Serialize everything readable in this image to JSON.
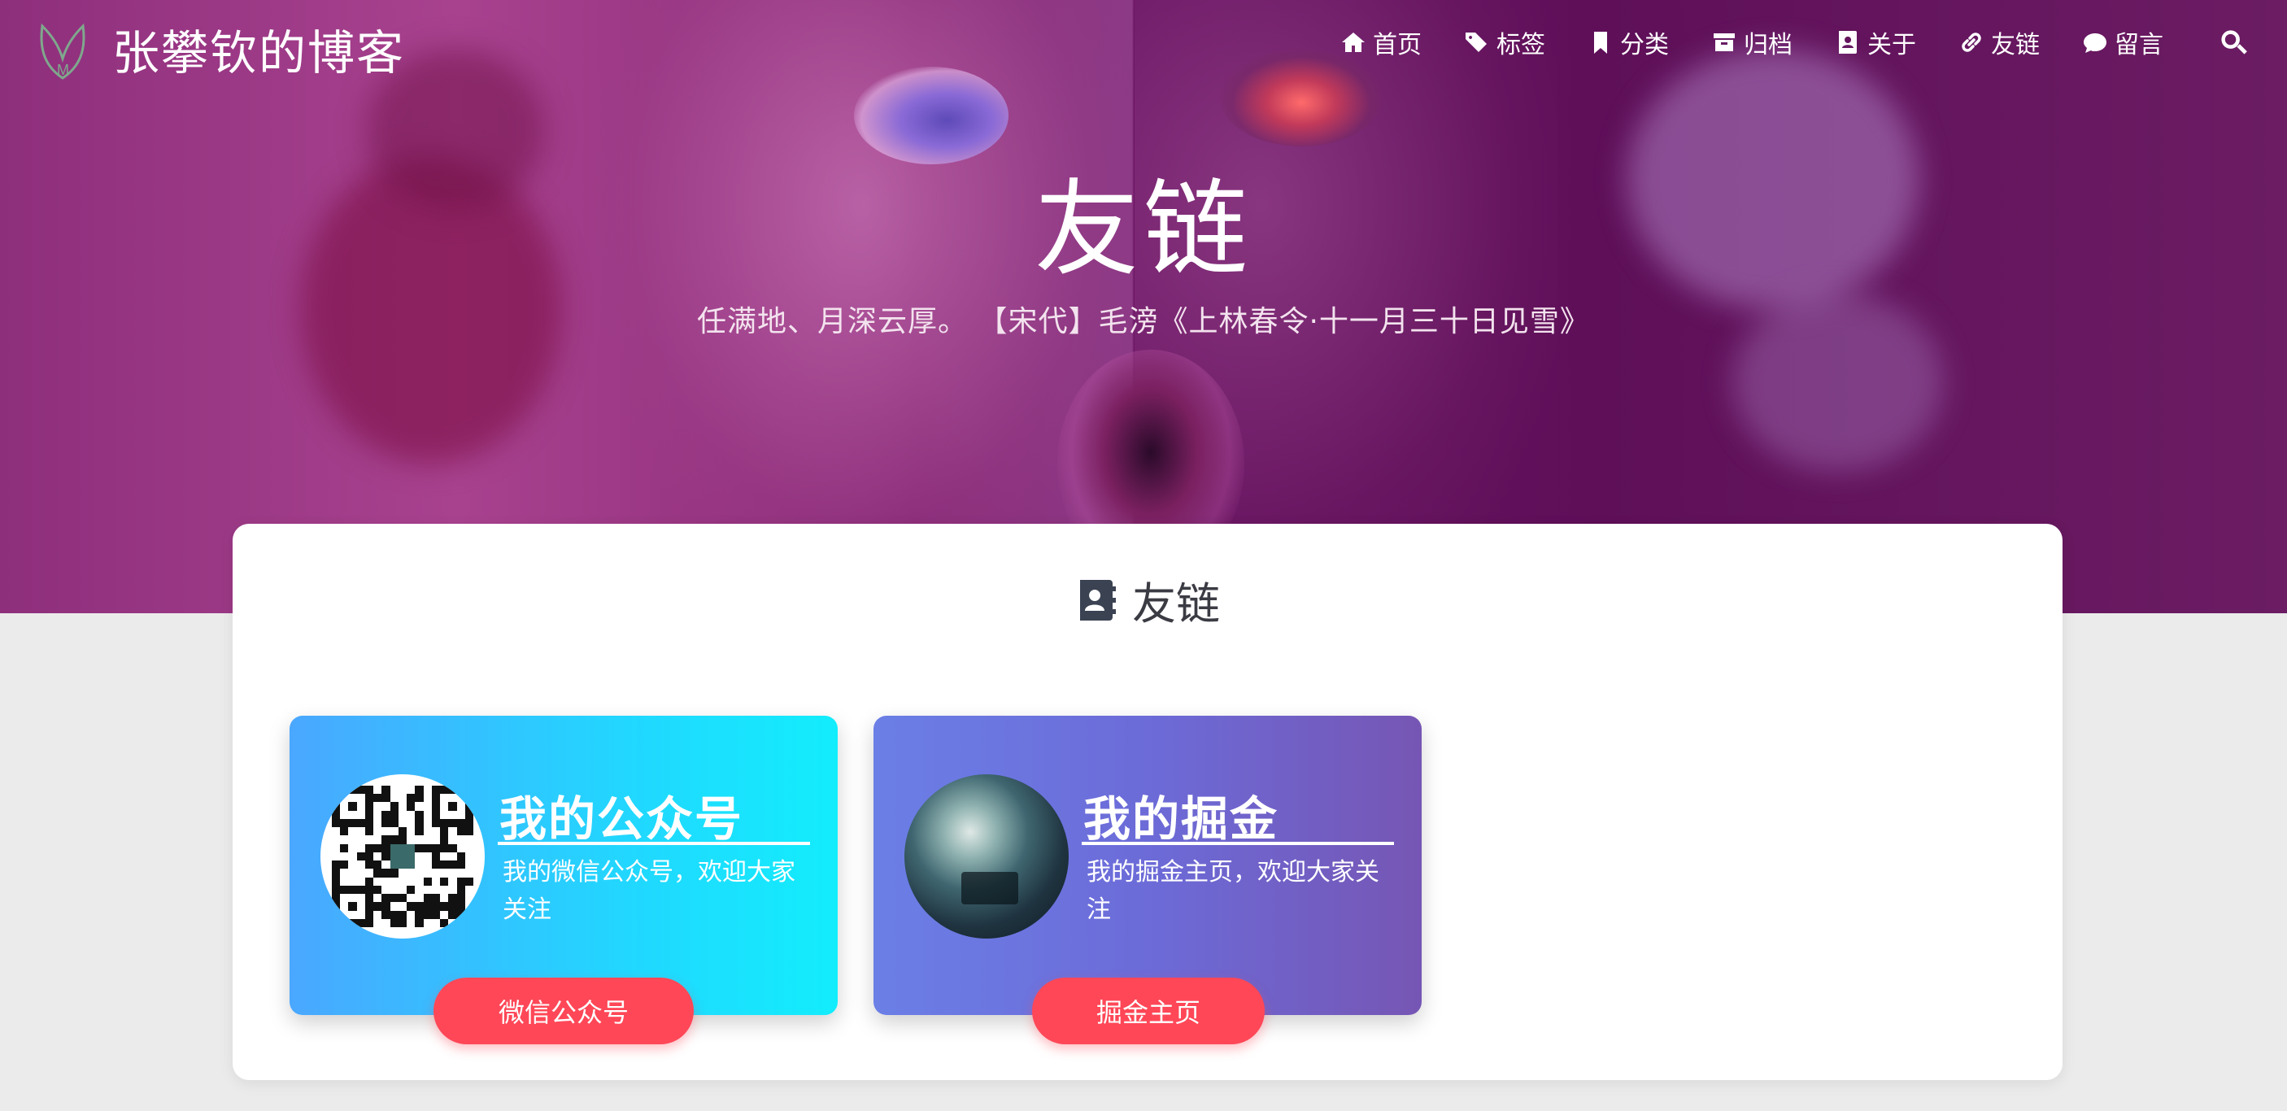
{
  "site": {
    "title": "张攀钦的博客",
    "logo_icon": "leaf-logo-icon"
  },
  "nav": {
    "items": [
      {
        "label": "首页",
        "icon": "home-icon"
      },
      {
        "label": "标签",
        "icon": "tags-icon"
      },
      {
        "label": "分类",
        "icon": "bookmark-icon"
      },
      {
        "label": "归档",
        "icon": "archive-icon"
      },
      {
        "label": "关于",
        "icon": "address-book-icon"
      },
      {
        "label": "友链",
        "icon": "link-icon"
      },
      {
        "label": "留言",
        "icon": "comment-icon"
      }
    ],
    "search_icon": "search-icon"
  },
  "hero": {
    "title": "友链",
    "subtitle": "任满地、月深云厚。 【宋代】毛滂《上林春令·十一月三十日见雪》"
  },
  "section": {
    "heading": "友链",
    "heading_icon": "address-book-icon"
  },
  "friends": [
    {
      "name": "我的公众号",
      "desc": "我的微信公众号，欢迎大家关注",
      "button": "微信公众号",
      "avatar": "qr-code-avatar"
    },
    {
      "name": "我的掘金",
      "desc": "我的掘金主页，欢迎大家关注",
      "button": "掘金主页",
      "avatar": "scenery-avatar"
    }
  ],
  "colors": {
    "accent_button": "#ff4757",
    "card1_gradient": [
      "#4aa7ff",
      "#12edfc"
    ],
    "card2_gradient": [
      "#6b7fe6",
      "#7656b4"
    ],
    "hero_base": "#8a2a78"
  }
}
